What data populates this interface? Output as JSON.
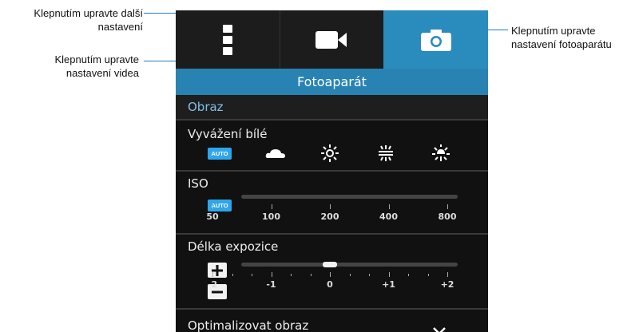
{
  "callouts": {
    "more_settings": "Klepnutím upravte další nastavení",
    "more_settings_line1": "Klepnutím upravte další",
    "more_settings_line2": "nastavení",
    "video_line1": "Klepnutím upravte",
    "video_line2": "nastavení videa",
    "camera_line1": "Klepnutím upravte",
    "camera_line2": "nastavení fotoaparátu"
  },
  "tabs": [
    {
      "name": "more",
      "icon": "more-vertical-icon"
    },
    {
      "name": "video",
      "icon": "video-camera-icon"
    },
    {
      "name": "camera",
      "icon": "camera-icon",
      "selected": true
    }
  ],
  "header": {
    "title": "Fotoaparát"
  },
  "section": {
    "title": "Obraz"
  },
  "white_balance": {
    "label": "Vyvážení bílé",
    "auto": "AUTO",
    "options": [
      "cloudy-icon",
      "sunny-icon",
      "fluorescent-icon",
      "incandescent-icon"
    ]
  },
  "iso": {
    "label": "ISO",
    "auto": "AUTO",
    "ticks": [
      "50",
      "100",
      "200",
      "400",
      "800"
    ]
  },
  "exposure": {
    "label": "Délka expozice",
    "ticks": [
      "-2",
      "-1",
      "0",
      "+1",
      "+2"
    ],
    "value": 0,
    "plus": "+",
    "minus": "−"
  },
  "optimize": {
    "label": "Optimalizovat obraz"
  },
  "colors": {
    "accent": "#2883b2",
    "selected_tab": "#2a8bbd",
    "auto_badge": "#2ea6ea",
    "callout_line": "#1f7db7"
  }
}
